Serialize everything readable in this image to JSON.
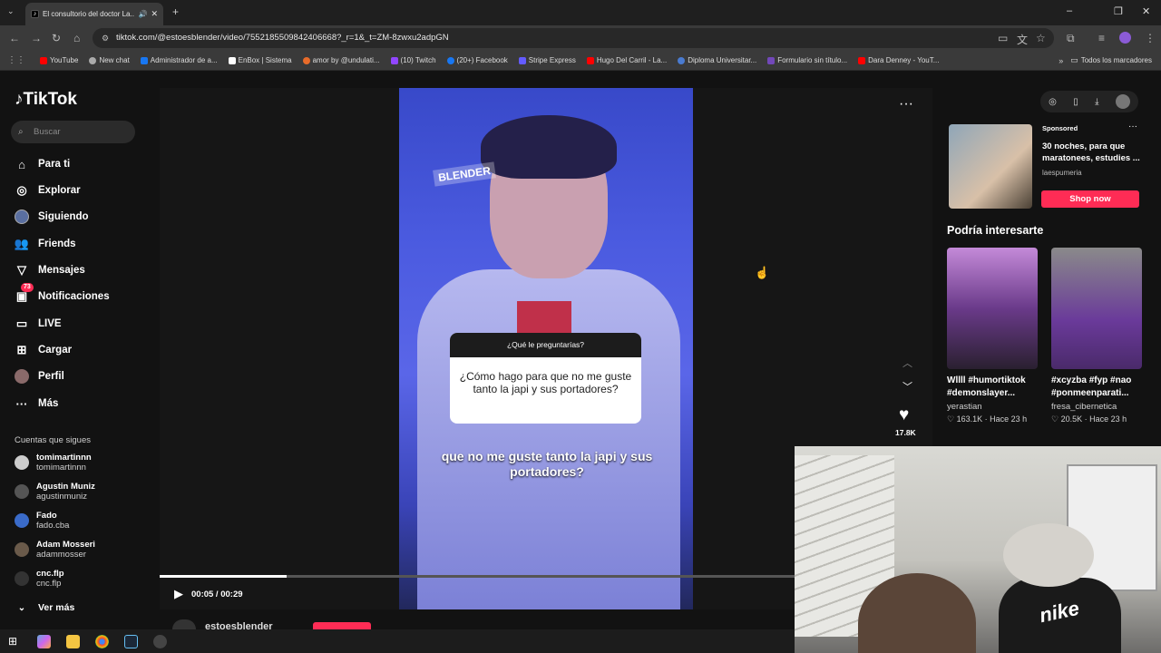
{
  "browser": {
    "tab_title": "El consultorio del doctor La...",
    "url": "tiktok.com/@estoesblender/video/7552185509842406668?_r=1&_t=ZM-8zwxu2adpGN",
    "bookmarks": [
      "YouTube",
      "New chat",
      "Administrador de a...",
      "EnBox | Sistema",
      "amor by @undulati...",
      "(10) Twitch",
      "(20+) Facebook",
      "Stripe Express",
      "Hugo Del Carril - La...",
      "Diploma Universitar...",
      "Formulario sin título...",
      "Dara Denney - YouT..."
    ],
    "all_bookmarks": "Todos los marcadores"
  },
  "sidebar": {
    "logo": "TikTok",
    "search_placeholder": "Buscar",
    "nav": [
      {
        "label": "Para ti",
        "icon": "home-icon"
      },
      {
        "label": "Explorar",
        "icon": "compass-icon"
      },
      {
        "label": "Siguiendo",
        "icon": "following-avatar-icon"
      },
      {
        "label": "Friends",
        "icon": "friends-icon"
      },
      {
        "label": "Mensajes",
        "icon": "messages-icon"
      },
      {
        "label": "Notificaciones",
        "icon": "notifications-icon",
        "badge": "73"
      },
      {
        "label": "LIVE",
        "icon": "live-icon"
      },
      {
        "label": "Cargar",
        "icon": "upload-icon"
      },
      {
        "label": "Perfil",
        "icon": "profile-avatar-icon"
      },
      {
        "label": "Más",
        "icon": "more-icon"
      }
    ],
    "following_title": "Cuentas que sigues",
    "accounts": [
      {
        "name": "tomimartinnn",
        "handle": "tomimartinnn"
      },
      {
        "name": "Agustin Muniz",
        "handle": "agustinmuniz"
      },
      {
        "name": "Fado",
        "handle": "fado.cba"
      },
      {
        "name": "Adam Mosseri",
        "handle": "adammosser"
      },
      {
        "name": "cnc.flp",
        "handle": "cnc.flp"
      }
    ],
    "see_more": "Ver más"
  },
  "video": {
    "watermark": "BLENDER",
    "question_header": "¿Qué le preguntarías?",
    "question": "¿Cómo hago para que no me guste tanto la japi y sus portadores?",
    "subtitle": "que no me guste tanto la japi y sus portadores?",
    "time": "00:05 / 00:29",
    "progress": 0.2,
    "likes": "17.8K",
    "creator": "estoesblender"
  },
  "right": {
    "sponsored": "Sponsored",
    "ad_title": "30 noches, para que maratonees, estudies ...",
    "ad_brand": "laespumeria",
    "ad_button": "Shop now",
    "rec_title": "Podría interesarte",
    "recs": [
      {
        "caption": "Wllll #humortiktok #demonslayer...",
        "user": "yerastian",
        "meta": "♡ 163.1K · Hace 23 h"
      },
      {
        "caption": "#xcyzba #fyp #nao #ponmeenparati...",
        "user": "fresa_cibernetica",
        "meta": "♡ 20.5K · Hace 23 h"
      }
    ]
  },
  "webcam": {
    "shirt_text": "nike"
  },
  "colors": {
    "accent": "#fe2c55",
    "background": "#121212"
  }
}
